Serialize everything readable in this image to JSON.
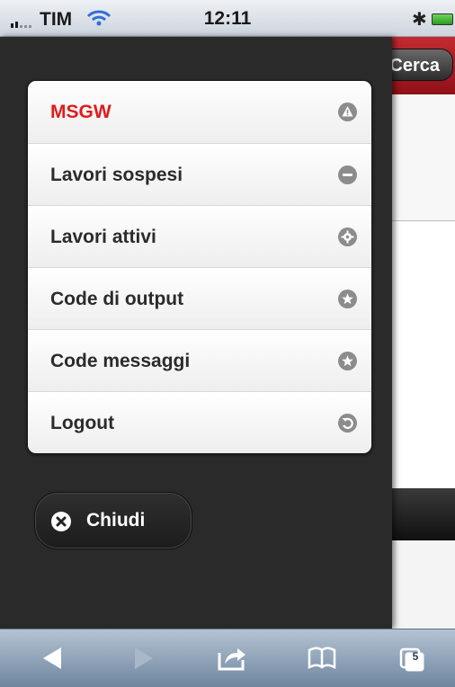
{
  "status_bar": {
    "carrier": "TIM",
    "time": "12:11"
  },
  "background_page": {
    "search_button_label": "Cerca"
  },
  "menu": {
    "items": [
      {
        "label": "MSGW",
        "icon": "alert-icon",
        "active": true
      },
      {
        "label": "Lavori sospesi",
        "icon": "minus-icon",
        "active": false
      },
      {
        "label": "Lavori attivi",
        "icon": "gear-icon",
        "active": false
      },
      {
        "label": "Code di output",
        "icon": "star-icon",
        "active": false
      },
      {
        "label": "Code messaggi",
        "icon": "star-icon",
        "active": false
      },
      {
        "label": "Logout",
        "icon": "refresh-icon",
        "active": false
      }
    ]
  },
  "close_button": {
    "label": "Chiudi",
    "icon": "close-icon"
  },
  "browser_toolbar": {
    "tab_count": "5"
  },
  "colors": {
    "active_item": "#e11b1b",
    "panel_bg": "#2a2a2a",
    "header_red": "#b01e25"
  }
}
